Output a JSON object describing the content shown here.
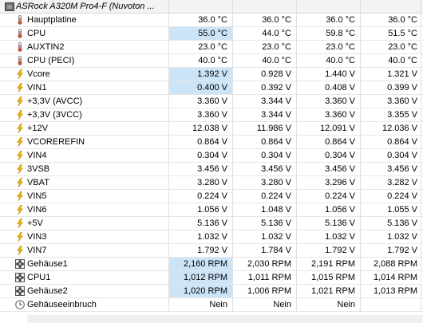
{
  "header": {
    "title": "ASRock A320M Pro4-F (Nuvoton ...",
    "icon": "chip-icon"
  },
  "rows": [
    {
      "label": "Hauptplatine",
      "icon": "thermometer-icon",
      "values": [
        "36.0 °C",
        "36.0 °C",
        "36.0 °C",
        "36.0 °C"
      ],
      "highlight": false
    },
    {
      "label": "CPU",
      "icon": "thermometer-icon",
      "values": [
        "55.0 °C",
        "44.0 °C",
        "59.8 °C",
        "51.5 °C"
      ],
      "highlight": true
    },
    {
      "label": "AUXTIN2",
      "icon": "thermometer-icon",
      "values": [
        "23.0 °C",
        "23.0 °C",
        "23.0 °C",
        "23.0 °C"
      ],
      "highlight": false
    },
    {
      "label": "CPU (PECI)",
      "icon": "thermometer-icon",
      "values": [
        "40.0 °C",
        "40.0 °C",
        "40.0 °C",
        "40.0 °C"
      ],
      "highlight": false
    },
    {
      "label": "Vcore",
      "icon": "lightning-icon",
      "values": [
        "1.392 V",
        "0.928 V",
        "1.440 V",
        "1.321 V"
      ],
      "highlight": true
    },
    {
      "label": "VIN1",
      "icon": "lightning-icon",
      "values": [
        "0.400 V",
        "0.392 V",
        "0.408 V",
        "0.399 V"
      ],
      "highlight": true
    },
    {
      "label": "+3,3V (AVCC)",
      "icon": "lightning-icon",
      "values": [
        "3.360 V",
        "3.344 V",
        "3.360 V",
        "3.360 V"
      ],
      "highlight": false
    },
    {
      "label": "+3,3V (3VCC)",
      "icon": "lightning-icon",
      "values": [
        "3.360 V",
        "3.344 V",
        "3.360 V",
        "3.355 V"
      ],
      "highlight": false
    },
    {
      "label": "+12V",
      "icon": "lightning-icon",
      "values": [
        "12.038 V",
        "11.986 V",
        "12.091 V",
        "12.036 V"
      ],
      "highlight": false
    },
    {
      "label": "VCOREREFIN",
      "icon": "lightning-icon",
      "values": [
        "0.864 V",
        "0.864 V",
        "0.864 V",
        "0.864 V"
      ],
      "highlight": false
    },
    {
      "label": "VIN4",
      "icon": "lightning-icon",
      "values": [
        "0.304 V",
        "0.304 V",
        "0.304 V",
        "0.304 V"
      ],
      "highlight": false
    },
    {
      "label": "3VSB",
      "icon": "lightning-icon",
      "values": [
        "3.456 V",
        "3.456 V",
        "3.456 V",
        "3.456 V"
      ],
      "highlight": false
    },
    {
      "label": "VBAT",
      "icon": "lightning-icon",
      "values": [
        "3.280 V",
        "3.280 V",
        "3.296 V",
        "3.282 V"
      ],
      "highlight": false
    },
    {
      "label": "VIN5",
      "icon": "lightning-icon",
      "values": [
        "0.224 V",
        "0.224 V",
        "0.224 V",
        "0.224 V"
      ],
      "highlight": false
    },
    {
      "label": "VIN6",
      "icon": "lightning-icon",
      "values": [
        "1.056 V",
        "1.048 V",
        "1.056 V",
        "1.055 V"
      ],
      "highlight": false
    },
    {
      "label": "+5V",
      "icon": "lightning-icon",
      "values": [
        "5.136 V",
        "5.136 V",
        "5.136 V",
        "5.136 V"
      ],
      "highlight": false
    },
    {
      "label": "VIN3",
      "icon": "lightning-icon",
      "values": [
        "1.032 V",
        "1.032 V",
        "1.032 V",
        "1.032 V"
      ],
      "highlight": false
    },
    {
      "label": "VIN7",
      "icon": "lightning-icon",
      "values": [
        "1.792 V",
        "1.784 V",
        "1.792 V",
        "1.792 V"
      ],
      "highlight": false
    },
    {
      "label": "Gehäuse1",
      "icon": "fan-icon",
      "values": [
        "2,160 RPM",
        "2,030 RPM",
        "2,191 RPM",
        "2,088 RPM"
      ],
      "highlight": true
    },
    {
      "label": "CPU1",
      "icon": "fan-icon",
      "values": [
        "1,012 RPM",
        "1,011 RPM",
        "1,015 RPM",
        "1,014 RPM"
      ],
      "highlight": true
    },
    {
      "label": "Gehäuse2",
      "icon": "fan-icon",
      "values": [
        "1,020 RPM",
        "1,006 RPM",
        "1,021 RPM",
        "1,013 RPM"
      ],
      "highlight": true
    },
    {
      "label": "Gehäuseeinbruch",
      "icon": "clock-icon",
      "values": [
        "Nein",
        "Nein",
        "Nein",
        ""
      ],
      "highlight": false
    }
  ],
  "colors": {
    "highlight": "#cce4f7",
    "thermometer": "#d24b2a",
    "lightning": "#f0b400",
    "fan": "#555555"
  }
}
